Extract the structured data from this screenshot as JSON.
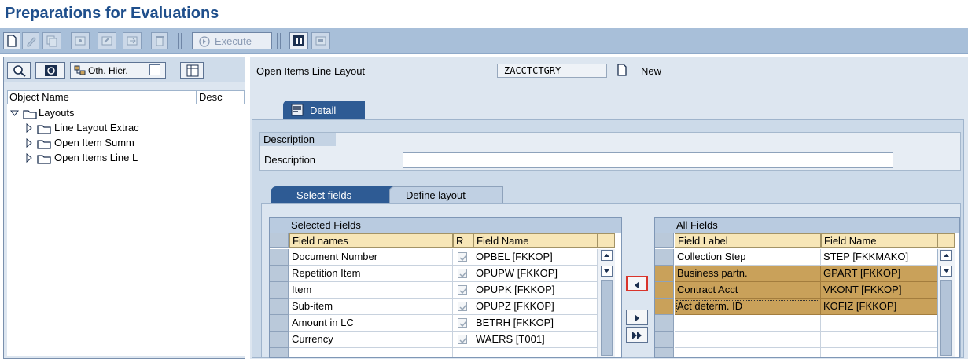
{
  "page": {
    "title": "Preparations for Evaluations"
  },
  "toolbar": {
    "execute_label": "Execute",
    "icons": [
      "new-document-icon",
      "edit-icon",
      "copy-icon",
      "display-icon",
      "change-icon",
      "delete-icon",
      "execute-icon",
      "info-icon",
      "transport-icon"
    ]
  },
  "leftpane": {
    "other_hierarchy_label": "Oth. Hier.",
    "tree_columns": {
      "object_name": "Object Name",
      "description": "Desc"
    },
    "tree": {
      "root": "Layouts",
      "children": [
        "Line Layout Extrac",
        "Open Item Summ",
        "Open Items Line L"
      ]
    }
  },
  "main": {
    "layout_label": "Open Items Line Layout",
    "layout_value": "ZACCTCTGRY",
    "new_label": "New",
    "detail_tab": "Detail",
    "description_group_title": "Description",
    "description_label": "Description",
    "description_value": "",
    "tabs": [
      "Select fields",
      "Define layout"
    ]
  },
  "selected_fields": {
    "title": "Selected Fields",
    "headers": [
      "Field names",
      "R",
      "Field Name"
    ],
    "rows": [
      {
        "name": "Document Number",
        "field": "OPBEL  [FKKOP]"
      },
      {
        "name": "Repetition Item",
        "field": "OPUPW  [FKKOP]"
      },
      {
        "name": "Item",
        "field": "OPUPK  [FKKOP]"
      },
      {
        "name": "Sub-item",
        "field": "OPUPZ  [FKKOP]"
      },
      {
        "name": "Amount in LC",
        "field": "BETRH  [FKKOP]"
      },
      {
        "name": "Currency",
        "field": "WAERS  [T001]"
      }
    ]
  },
  "all_fields": {
    "title": "All Fields",
    "headers": [
      "Field Label",
      "Field Name"
    ],
    "rows": [
      {
        "label": "Collection Step",
        "field": "STEP  [FKKMAKO]",
        "selected": false
      },
      {
        "label": "Business partn.",
        "field": "GPART  [FKKOP]",
        "selected": true
      },
      {
        "label": "Contract Acct",
        "field": "VKONT  [FKKOP]",
        "selected": true
      },
      {
        "label": "Act determ. ID",
        "field": "KOFIZ  [FKKOP]",
        "selected": true
      }
    ]
  },
  "colors": {
    "title": "#1f4f8c",
    "toolbar": "#a8bfd9",
    "tab_active": "#2e5b94",
    "header_cell": "#f7e6b7",
    "selection": "#c9a15a"
  }
}
